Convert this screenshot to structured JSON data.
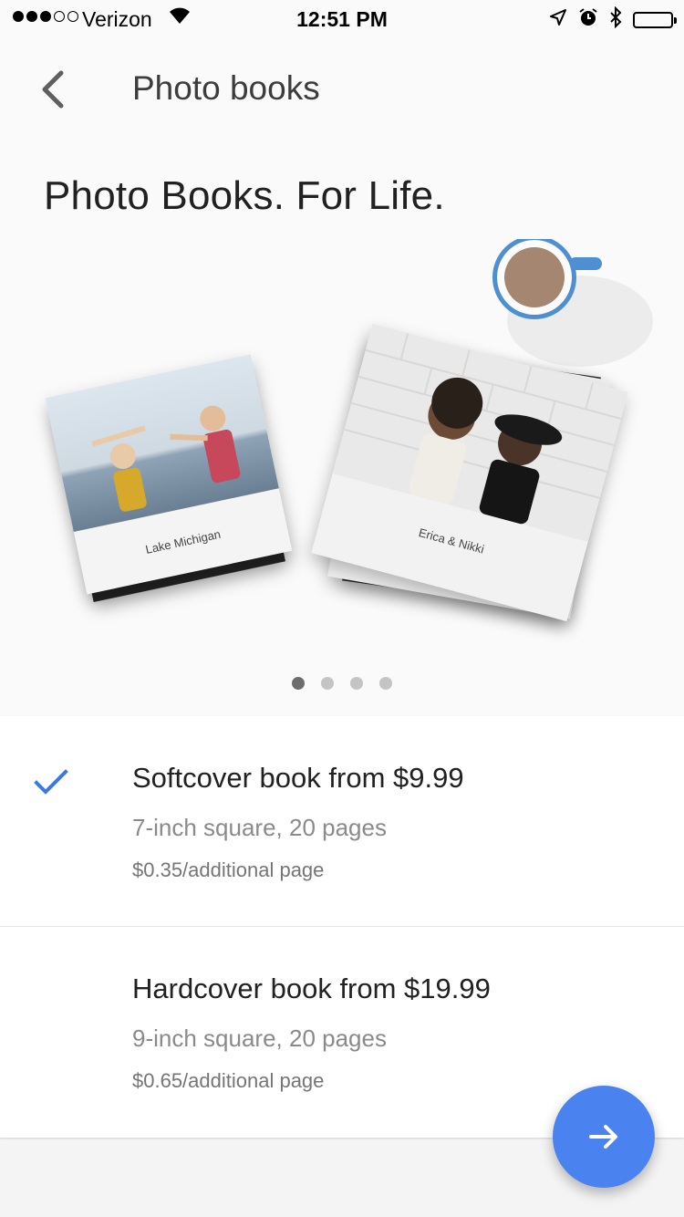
{
  "status_bar": {
    "carrier": "Verizon",
    "time": "12:51 PM"
  },
  "header": {
    "title": "Photo books"
  },
  "hero": {
    "title": "Photo Books. For Life.",
    "books": [
      {
        "caption": "Lake Michigan"
      },
      {
        "caption": "Erica & Nikki"
      }
    ],
    "pagination": {
      "total": 4,
      "active_index": 0
    }
  },
  "options": [
    {
      "title": "Softcover book from $9.99",
      "subtitle": "7-inch square, 20 pages",
      "price_note": "$0.35/additional page",
      "selected": true
    },
    {
      "title": "Hardcover book from $19.99",
      "subtitle": "9-inch square, 20 pages",
      "price_note": "$0.65/additional page",
      "selected": false
    }
  ],
  "colors": {
    "accent": "#4a82ef",
    "check": "#3b78e7"
  },
  "icons": {
    "back": "chevron-left-icon",
    "next": "arrow-right-icon",
    "selected": "check-icon"
  }
}
